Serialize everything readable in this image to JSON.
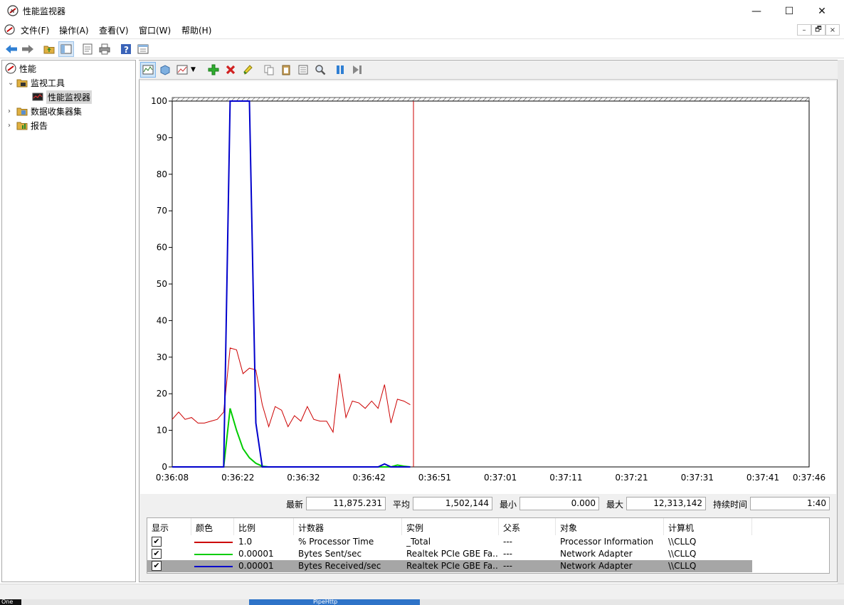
{
  "window": {
    "title": "性能监视器",
    "minimize_glyph": "—",
    "maximize_glyph": "☐",
    "close_glyph": "✕"
  },
  "menu": [
    "文件(F)",
    "操作(A)",
    "查看(V)",
    "窗口(W)",
    "帮助(H)"
  ],
  "mdi_controls": [
    "–",
    "🗗",
    "×"
  ],
  "tree": {
    "root": "性能",
    "items": [
      {
        "label": "监视工具",
        "expanded": true
      },
      {
        "label": "性能监视器",
        "selected": true
      },
      {
        "label": "数据收集器集",
        "expanded": false
      },
      {
        "label": "报告",
        "expanded": false
      }
    ]
  },
  "chart_data": {
    "type": "line",
    "ylim": [
      0,
      100
    ],
    "yticks": [
      0,
      10,
      20,
      30,
      40,
      50,
      60,
      70,
      80,
      90,
      100
    ],
    "xticks": [
      "0:36:08",
      "0:36:22",
      "0:36:32",
      "0:36:42",
      "0:36:51",
      "0:37:01",
      "0:37:11",
      "0:37:21",
      "0:37:31",
      "0:37:41",
      "0:37:46"
    ],
    "cursor_sample": 33,
    "total_samples": 100,
    "series": [
      {
        "name": "% Processor Time",
        "color": "#cc0000",
        "values": [
          13,
          15,
          13,
          13.5,
          12,
          12,
          12.5,
          13,
          15,
          32.5,
          32,
          25.5,
          27,
          26.5,
          17,
          11,
          16.5,
          15.5,
          11,
          14,
          12.5,
          16.5,
          13,
          12.5,
          12.5,
          9.5,
          25.5,
          13.5,
          18,
          17.5,
          16,
          18,
          16,
          22.5,
          12,
          18.5,
          18,
          17
        ]
      },
      {
        "name": "Bytes Sent/sec",
        "color": "#00cc00",
        "values": [
          0,
          0,
          0,
          0,
          0,
          0,
          0,
          0,
          0,
          16,
          10,
          5,
          2.5,
          1,
          0.2,
          0,
          0,
          0,
          0,
          0,
          0,
          0,
          0,
          0,
          0,
          0,
          0,
          0,
          0,
          0,
          0,
          0,
          0,
          0,
          0,
          0.5,
          0.2,
          0
        ]
      },
      {
        "name": "Bytes Received/sec",
        "color": "#0000cc",
        "values": [
          0,
          0,
          0,
          0,
          0,
          0,
          0,
          0,
          0,
          100,
          100,
          100,
          100,
          12,
          0,
          0,
          0,
          0,
          0,
          0,
          0,
          0,
          0,
          0,
          0,
          0,
          0,
          0,
          0,
          0,
          0,
          0,
          0,
          0.8,
          0,
          0,
          0,
          0
        ]
      }
    ]
  },
  "stats": {
    "last_label": "最新",
    "last": "11,875.231",
    "avg_label": "平均",
    "avg": "1,502,144",
    "min_label": "最小",
    "min": "0.000",
    "max_label": "最大",
    "max": "12,313,142",
    "duration_label": "持续时间",
    "duration": "1:40"
  },
  "counter_table": {
    "headers": [
      "显示",
      "颜色",
      "比例",
      "计数器",
      "实例",
      "父系",
      "对象",
      "计算机"
    ],
    "rows": [
      {
        "show": "✔",
        "color": "#cc0000",
        "scale": "1.0",
        "counter": "% Processor Time",
        "instance": "_Total",
        "parent": "---",
        "object": "Processor Information",
        "computer": "\\\\CLLQ",
        "selected": false
      },
      {
        "show": "✔",
        "color": "#00cc00",
        "scale": "0.00001",
        "counter": "Bytes Sent/sec",
        "instance": "Realtek PCIe GBE Fa...",
        "parent": "---",
        "object": "Network Adapter",
        "computer": "\\\\CLLQ",
        "selected": false
      },
      {
        "show": "✔",
        "color": "#0000cc",
        "scale": "0.00001",
        "counter": "Bytes Received/sec",
        "instance": "Realtek PCIe GBE Fa...",
        "parent": "---",
        "object": "Network Adapter",
        "computer": "\\\\CLLQ",
        "selected": true
      }
    ]
  },
  "taskbar": {
    "left_text": "One",
    "task_text": "PipeHttp"
  }
}
